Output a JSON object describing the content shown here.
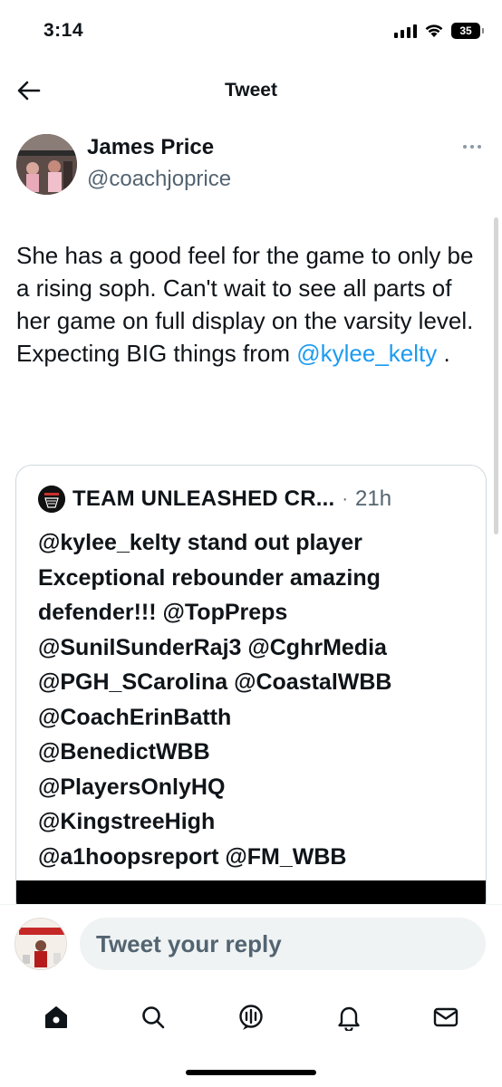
{
  "status_bar": {
    "time": "3:14",
    "battery": "35",
    "icons": [
      "signal-icon",
      "wifi-icon",
      "battery-icon"
    ]
  },
  "header": {
    "title": "Tweet",
    "back_icon": "arrow-left-icon"
  },
  "tweet": {
    "author_name": "James Price",
    "author_handle": "@coachjoprice",
    "text_before": "She has a good feel for the game to only be a rising soph. Can't wait to see all parts of her game on full display on the varsity level. Expecting BIG things from ",
    "mention": "@kylee_kelty",
    "text_after": " ."
  },
  "quote": {
    "author_name": "TEAM UNLEASHED CR...",
    "separator": "·",
    "time": "21h",
    "lines": [
      "@kylee_kelty stand out player",
      "Exceptional rebounder amazing",
      "defender!!! @TopPreps",
      "@SunilSunderRaj3 @CghrMedia",
      "@PGH_SCarolina @CoastalWBB",
      "@CoachErinBatth",
      "@BenedictWBB",
      "@PlayersOnlyHQ",
      "@KingstreeHigh",
      "@a1hoopsreport @FM_WBB"
    ]
  },
  "reply": {
    "placeholder": "Tweet your reply"
  },
  "bottom_nav": {
    "items": [
      "home-icon",
      "search-icon",
      "spaces-icon",
      "notifications-icon",
      "messages-icon"
    ]
  },
  "colors": {
    "text": "#0f1419",
    "secondary": "#536471",
    "link": "#1d9bf0",
    "border": "#cfd9de",
    "input_bg": "#eff3f4"
  }
}
